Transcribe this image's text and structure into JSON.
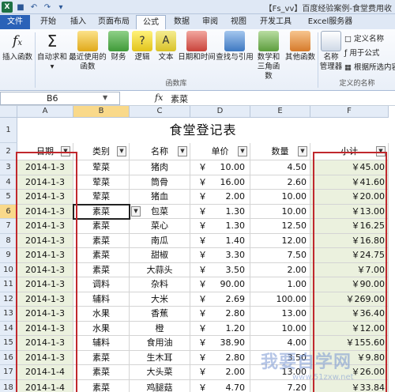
{
  "window": {
    "title": "【Fs_vv】百度经验案例-食堂费用收"
  },
  "ribbon_tabs": [
    "文件",
    "开始",
    "插入",
    "页面布局",
    "公式",
    "数据",
    "审阅",
    "视图",
    "开发工具",
    "Excel服务器"
  ],
  "ribbon": {
    "insert_function": "插入函数",
    "autosum_l1": "自动求和",
    "recent_l1": "最近使用的",
    "recent_l2": "函数",
    "financial": "财务",
    "logical": "逻辑",
    "text": "文本",
    "datetime": "日期和时间",
    "lookup": "查找与引用",
    "math_l1": "数学和",
    "math_l2": "三角函数",
    "more": "其他函数",
    "name_mgr_l1": "名称",
    "name_mgr_l2": "管理器",
    "define_name": "定义名称",
    "use_in_formula": "用于公式",
    "create_from_sel": "根据所选内容",
    "group_library": "函数库",
    "group_names": "定义的名称"
  },
  "formula_bar": {
    "name_box": "B6",
    "fx": "fx",
    "value": "素菜"
  },
  "columns": [
    "A",
    "B",
    "C",
    "D",
    "E",
    "F"
  ],
  "sheet_title": "食堂登记表",
  "headers": [
    "日期",
    "类别",
    "名称",
    "单价",
    "数量",
    "小计"
  ],
  "row_numbers": [
    "1",
    "2",
    "3",
    "4",
    "5",
    "6",
    "7",
    "8",
    "9",
    "10",
    "11",
    "12",
    "13",
    "14",
    "15",
    "16",
    "17",
    "18"
  ],
  "currency": "￥",
  "rows": [
    {
      "date": "2014-1-3",
      "cat": "荤菜",
      "name": "猪肉",
      "price": "10.00",
      "qty": "4.50",
      "total": "￥45.00"
    },
    {
      "date": "2014-1-3",
      "cat": "荤菜",
      "name": "筒骨",
      "price": "16.00",
      "qty": "2.60",
      "total": "￥41.60"
    },
    {
      "date": "2014-1-3",
      "cat": "荤菜",
      "name": "猪血",
      "price": "2.00",
      "qty": "10.00",
      "total": "￥20.00"
    },
    {
      "date": "2014-1-3",
      "cat": "素菜",
      "name": "包菜",
      "price": "1.30",
      "qty": "10.00",
      "total": "￥13.00"
    },
    {
      "date": "2014-1-3",
      "cat": "素菜",
      "name": "菜心",
      "price": "1.30",
      "qty": "12.50",
      "total": "￥16.25"
    },
    {
      "date": "2014-1-3",
      "cat": "素菜",
      "name": "南瓜",
      "price": "1.40",
      "qty": "12.00",
      "total": "￥16.80"
    },
    {
      "date": "2014-1-3",
      "cat": "素菜",
      "name": "甜椒",
      "price": "3.30",
      "qty": "7.50",
      "total": "￥24.75"
    },
    {
      "date": "2014-1-3",
      "cat": "素菜",
      "name": "大蒜头",
      "price": "3.50",
      "qty": "2.00",
      "total": "￥7.00"
    },
    {
      "date": "2014-1-3",
      "cat": "调料",
      "name": "杂料",
      "price": "90.00",
      "qty": "1.00",
      "total": "￥90.00"
    },
    {
      "date": "2014-1-3",
      "cat": "辅料",
      "name": "大米",
      "price": "2.69",
      "qty": "100.00",
      "total": "￥269.00"
    },
    {
      "date": "2014-1-3",
      "cat": "水果",
      "name": "香蕉",
      "price": "2.80",
      "qty": "13.00",
      "total": "￥36.40"
    },
    {
      "date": "2014-1-3",
      "cat": "水果",
      "name": "橙",
      "price": "1.20",
      "qty": "10.00",
      "total": "￥12.00"
    },
    {
      "date": "2014-1-3",
      "cat": "辅料",
      "name": "食用油",
      "price": "38.90",
      "qty": "4.00",
      "total": "￥155.60"
    },
    {
      "date": "2014-1-3",
      "cat": "素菜",
      "name": "生木耳",
      "price": "2.80",
      "qty": "3.50",
      "total": "￥9.80"
    },
    {
      "date": "2014-1-4",
      "cat": "素菜",
      "name": "大头菜",
      "price": "2.00",
      "qty": "13.00",
      "total": "￥26.00"
    },
    {
      "date": "2014-1-4",
      "cat": "素菜",
      "name": "鸡腿菇",
      "price": "4.70",
      "qty": "7.20",
      "total": "￥33.84"
    }
  ],
  "watermark": {
    "text": "我要自学网",
    "sub": "www.51zxw.net"
  },
  "colors": {
    "accent": "#2a62b8",
    "highlight_green": "#ebf1de",
    "red_box": "#c0282d"
  }
}
